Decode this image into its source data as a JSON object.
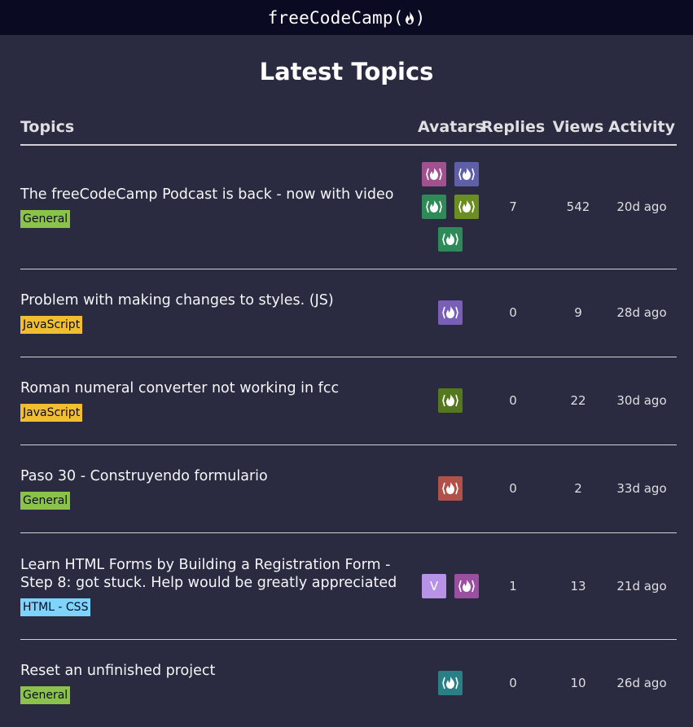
{
  "header": {
    "logo": "freeCodeCamp(🔥)"
  },
  "page_title": "Latest Topics",
  "columns": {
    "topics": "Topics",
    "avatars": "Avatars",
    "replies": "Replies",
    "views": "Views",
    "activity": "Activity"
  },
  "colors": {
    "general": "#8bc34a",
    "javascript": "#f1be32",
    "html_css": "#7fd4fb"
  },
  "topics": [
    {
      "title": "The freeCodeCamp Podcast is back - now with video",
      "tag": "General",
      "replies": "7",
      "views": "542",
      "activity": "20d ago",
      "avatars": [
        "flame-icon",
        "flame-icon",
        "flame-icon",
        "flame-icon",
        "flame-icon"
      ]
    },
    {
      "title": "Problem with making changes to styles. (JS)",
      "tag": "JavaScript",
      "replies": "0",
      "views": "9",
      "activity": "28d ago",
      "avatars": [
        "flame-icon"
      ]
    },
    {
      "title": "Roman numeral converter not working in fcc",
      "tag": "JavaScript",
      "replies": "0",
      "views": "22",
      "activity": "30d ago",
      "avatars": [
        "flame-icon"
      ]
    },
    {
      "title": "Paso 30 - Construyendo formulario",
      "tag": "General",
      "replies": "0",
      "views": "2",
      "activity": "33d ago",
      "avatars": [
        "flame-icon"
      ]
    },
    {
      "title": "Learn HTML Forms by Building a Registration Form - Step 8: got stuck. Help would be greatly appreciated",
      "tag": "HTML - CSS",
      "replies": "1",
      "views": "13",
      "activity": "21d ago",
      "avatars": [
        "V",
        "flame-icon"
      ]
    },
    {
      "title": "Reset an unfinished project",
      "tag": "General",
      "replies": "0",
      "views": "10",
      "activity": "26d ago",
      "avatars": [
        "flame-icon"
      ]
    }
  ]
}
